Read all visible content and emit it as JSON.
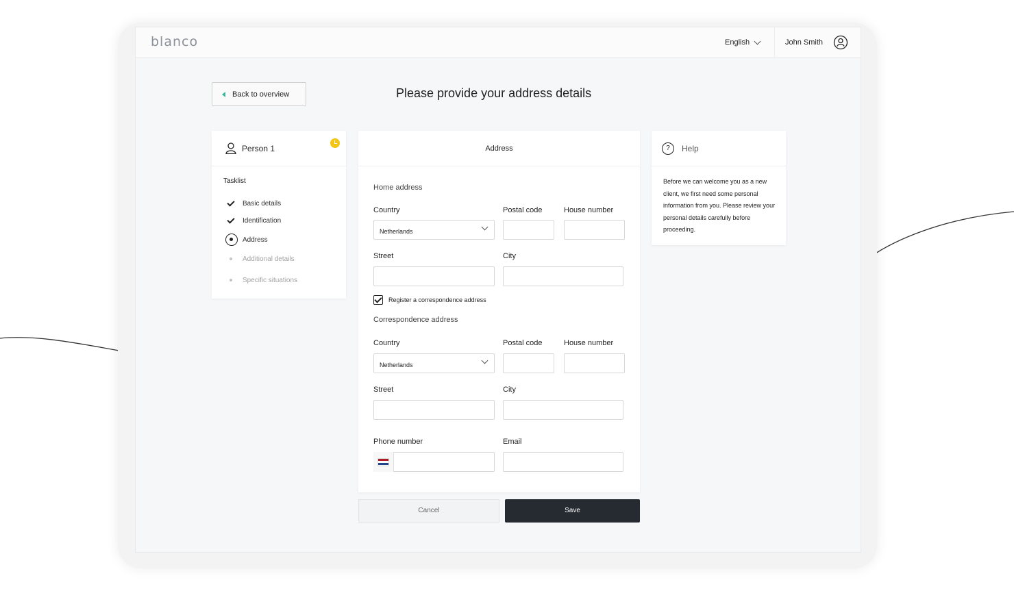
{
  "header": {
    "logo": "blanco",
    "language": "English",
    "user_name": "John Smith"
  },
  "nav": {
    "back_label": "Back to overview"
  },
  "page_title": "Please provide your address details",
  "tasks": {
    "person_label": "Person 1",
    "tasklist_title": "Tasklist",
    "items": [
      {
        "label": "Basic details",
        "status": "done"
      },
      {
        "label": "Identification",
        "status": "done"
      },
      {
        "label": "Address",
        "status": "current"
      },
      {
        "label": "Additional details",
        "status": "pending"
      },
      {
        "label": "Specific situations",
        "status": "pending"
      }
    ]
  },
  "form": {
    "title": "Address",
    "home": {
      "section_title": "Home address",
      "country_label": "Country",
      "country_value": "Netherlands",
      "postal_label": "Postal code",
      "house_label": "House number",
      "street_label": "Street",
      "city_label": "City"
    },
    "correspondence_checkbox": "Register a correspondence address",
    "correspondence_checked": true,
    "correspondence": {
      "section_title": "Correspondence address",
      "country_label": "Country",
      "country_value": "Netherlands",
      "postal_label": "Postal code",
      "house_label": "House number",
      "street_label": "Street",
      "city_label": "City"
    },
    "phone_label": "Phone number",
    "email_label": "Email"
  },
  "help": {
    "title": "Help",
    "text": "Before we can welcome you as a new client, we first need some personal information from you. Please review your personal details carefully before proceeding."
  },
  "actions": {
    "cancel_label": "Cancel",
    "save_label": "Save"
  },
  "colors": {
    "save_button": "#262a31",
    "accent_back_arrow": "#3bb89b",
    "pending_badge": "#f3c515"
  }
}
